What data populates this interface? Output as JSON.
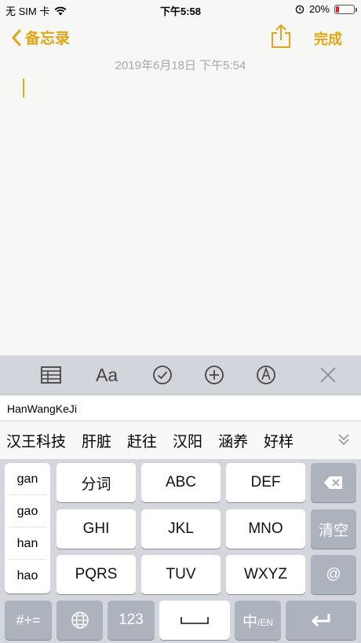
{
  "status": {
    "carrier": "无 SIM 卡",
    "time": "下午5:58",
    "battery_text": "20%",
    "battery_level": 0.2
  },
  "nav": {
    "back_label": "备忘录",
    "done_label": "完成"
  },
  "note": {
    "date": "2019年6月18日 下午5:54"
  },
  "toolbar": {
    "format_label": "Aa"
  },
  "composition": {
    "text": "HanWangKeJi"
  },
  "candidates": [
    "汉王科技",
    "肝脏",
    "赶往",
    "汉阳",
    "涵养",
    "好样"
  ],
  "pinyin": [
    "gan",
    "gao",
    "han",
    "hao"
  ],
  "keys": {
    "r1": [
      "分词",
      "ABC",
      "DEF"
    ],
    "r2": [
      "GHI",
      "JKL",
      "MNO"
    ],
    "r3": [
      "PQRS",
      "TUV",
      "WXYZ"
    ],
    "clear": "清空",
    "at": "@",
    "symbols": "#+=",
    "num": "123",
    "lang_main": "中",
    "lang_sub": "/EN"
  },
  "colors": {
    "accent": "#e0a615",
    "battery_low": "#e0232e"
  }
}
